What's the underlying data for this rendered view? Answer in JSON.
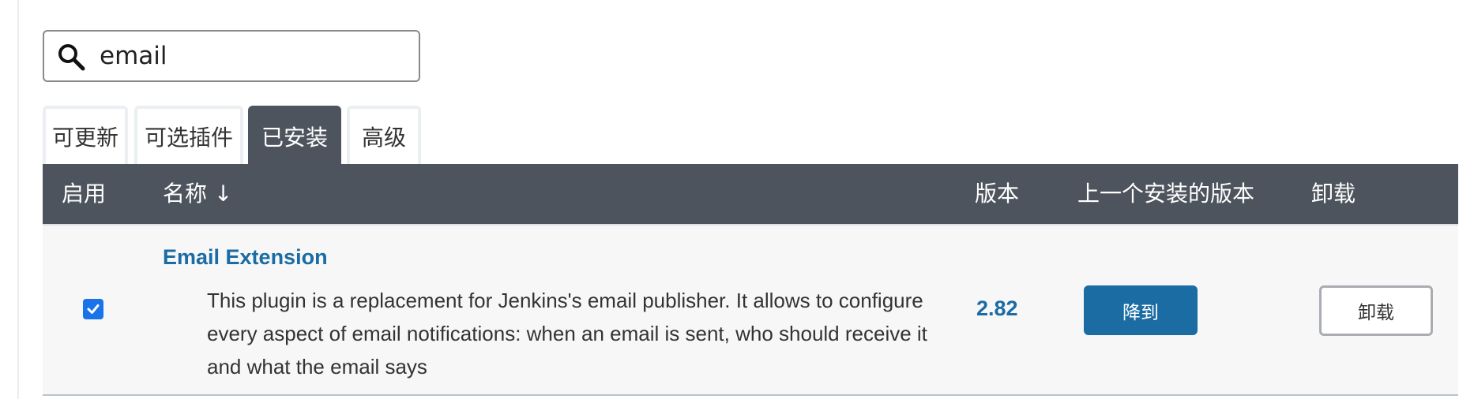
{
  "search": {
    "value": "email"
  },
  "tabs": [
    {
      "label": "可更新"
    },
    {
      "label": "可选插件"
    },
    {
      "label": "已安装",
      "active": true
    },
    {
      "label": "高级"
    }
  ],
  "table": {
    "headers": {
      "enabled": "启用",
      "name": "名称 ↓",
      "version": "版本",
      "previous_version": "上一个安装的版本",
      "uninstall": "卸载"
    },
    "rows": [
      {
        "enabled": true,
        "name": "Email Extension",
        "description": "This plugin is a replacement for Jenkins's email publisher. It allows to configure every aspect of email notifications: when an email is sent, who should receive it and what the email says",
        "version": "2.82",
        "downgrade_label": "降到",
        "uninstall_label": "卸载"
      }
    ]
  },
  "colors": {
    "header_bg": "#4d545d",
    "link": "#1a6ca3",
    "primary_button": "#1a6ca3",
    "checkbox": "#1a73e8"
  },
  "icons": {
    "search": "search-icon",
    "checkbox": "checkmark-icon"
  }
}
